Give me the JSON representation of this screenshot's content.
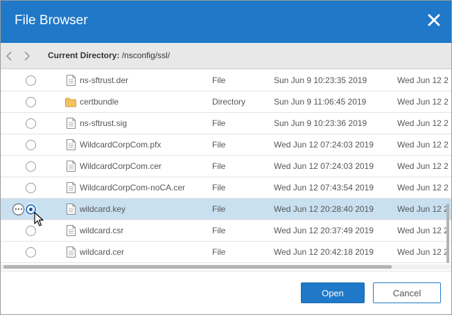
{
  "dialog": {
    "title": "File Browser",
    "close_icon": "close-icon"
  },
  "nav": {
    "back_icon": "chevron-left-icon",
    "forward_icon": "chevron-right-icon",
    "current_directory_label": "Current Directory:",
    "current_directory_path": " /nsconfig/ssl/"
  },
  "files": [
    {
      "name": "ns-sftrust.der",
      "type": "File",
      "created": "Sun Jun  9 10:23:35 2019",
      "modified": "Wed Jun 12 2",
      "icon": "file-icon",
      "selected": false
    },
    {
      "name": "certbundle",
      "type": "Directory",
      "created": "Sun Jun  9 11:06:45 2019",
      "modified": "Wed Jun 12 2",
      "icon": "folder-icon",
      "selected": false
    },
    {
      "name": "ns-sftrust.sig",
      "type": "File",
      "created": "Sun Jun  9 10:23:36 2019",
      "modified": "Wed Jun 12 2",
      "icon": "file-icon",
      "selected": false
    },
    {
      "name": "WildcardCorpCom.pfx",
      "type": "File",
      "created": "Wed Jun 12 07:24:03 2019",
      "modified": "Wed Jun 12 2",
      "icon": "file-icon",
      "selected": false
    },
    {
      "name": "WildcardCorpCom.cer",
      "type": "File",
      "created": "Wed Jun 12 07:24:03 2019",
      "modified": "Wed Jun 12 2",
      "icon": "file-icon",
      "selected": false
    },
    {
      "name": "WildcardCorpCom-noCA.cer",
      "type": "File",
      "created": "Wed Jun 12 07:43:54 2019",
      "modified": "Wed Jun 12 2",
      "icon": "file-icon",
      "selected": false
    },
    {
      "name": "wildcard.key",
      "type": "File",
      "created": "Wed Jun 12 20:28:40 2019",
      "modified": "Wed Jun 12 2",
      "icon": "file-icon",
      "selected": true
    },
    {
      "name": "wildcard.csr",
      "type": "File",
      "created": "Wed Jun 12 20:37:49 2019",
      "modified": "Wed Jun 12 2",
      "icon": "file-icon",
      "selected": false
    },
    {
      "name": "wildcard.cer",
      "type": "File",
      "created": "Wed Jun 12 20:42:18 2019",
      "modified": "Wed Jun 12 2",
      "icon": "file-icon",
      "selected": false
    }
  ],
  "selected_row_actions_icon": "more-options-icon",
  "footer": {
    "open_label": "Open",
    "cancel_label": "Cancel"
  },
  "colors": {
    "accent": "#1f78c8",
    "selected_row": "#c9e0f1",
    "navbar": "#e8e8e8",
    "folder": "#f2b84b"
  }
}
